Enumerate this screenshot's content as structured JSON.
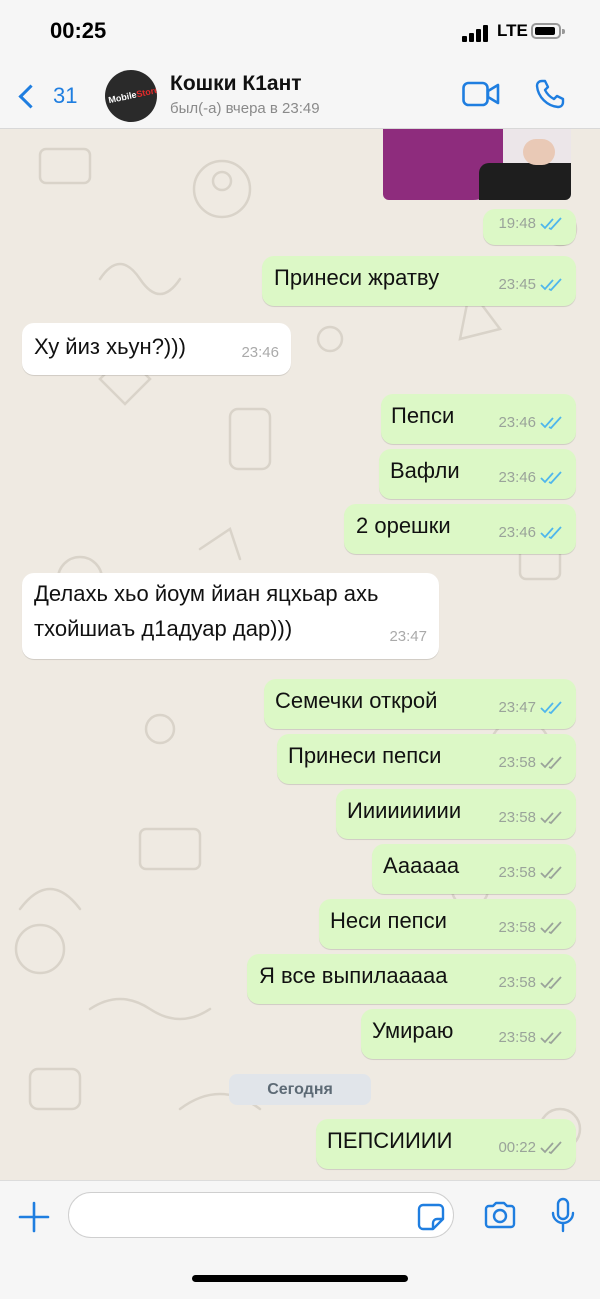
{
  "status_bar": {
    "time": "00:25",
    "network": "LTE"
  },
  "header": {
    "back_count": "31",
    "contact_name": "Кошки К1ант",
    "last_seen": "был(-а) вчера в 23:49"
  },
  "messages": [
    {
      "direction": "out",
      "text": "",
      "time": "19:48",
      "ticks": "read"
    },
    {
      "direction": "out",
      "text": "Принеси жратву",
      "time": "23:45",
      "ticks": "read"
    },
    {
      "direction": "in",
      "text": "Ху йиз хьун?)))",
      "time": "23:46"
    },
    {
      "direction": "out",
      "text": "Пепси",
      "time": "23:46",
      "ticks": "read"
    },
    {
      "direction": "out",
      "text": "Вафли",
      "time": "23:46",
      "ticks": "read"
    },
    {
      "direction": "out",
      "text": "2 орешки",
      "time": "23:46",
      "ticks": "read"
    },
    {
      "direction": "in",
      "text_line1": "Делахь хьо йоум йиан яцхьар ахь",
      "text_line2": "тхойшиаъ д1адуар дар)))",
      "time": "23:47"
    },
    {
      "direction": "out",
      "text": "Семечки открой",
      "time": "23:47",
      "ticks": "read"
    },
    {
      "direction": "out",
      "text": "Принеси пепси",
      "time": "23:58",
      "ticks": "delivered"
    },
    {
      "direction": "out",
      "text": "Иииииииии",
      "time": "23:58",
      "ticks": "delivered"
    },
    {
      "direction": "out",
      "text": "Аааааа",
      "time": "23:58",
      "ticks": "delivered"
    },
    {
      "direction": "out",
      "text": "Неси пепси",
      "time": "23:58",
      "ticks": "delivered"
    },
    {
      "direction": "out",
      "text": "Я все выпилааааа",
      "time": "23:58",
      "ticks": "delivered"
    },
    {
      "direction": "out",
      "text": "Умираю",
      "time": "23:58",
      "ticks": "delivered"
    },
    {
      "direction": "out",
      "text": "ПЕПСИИИИ",
      "time": "00:22",
      "ticks": "delivered"
    }
  ],
  "day_separator": "Сегодня",
  "avatar_logo": {
    "part1": "Mobile",
    "part2": "Store"
  },
  "colors": {
    "accent": "#1f7ee0",
    "outgoing_bubble": "#dcf8c6",
    "incoming_bubble": "#ffffff",
    "chat_background": "#efeae2",
    "read_ticks": "#4fb6ec",
    "delivered_ticks": "#9aa39a"
  },
  "icons": [
    "back-chevron-icon",
    "video-call-icon",
    "phone-call-icon",
    "plus-icon",
    "sticker-icon",
    "camera-icon",
    "microphone-icon"
  ]
}
